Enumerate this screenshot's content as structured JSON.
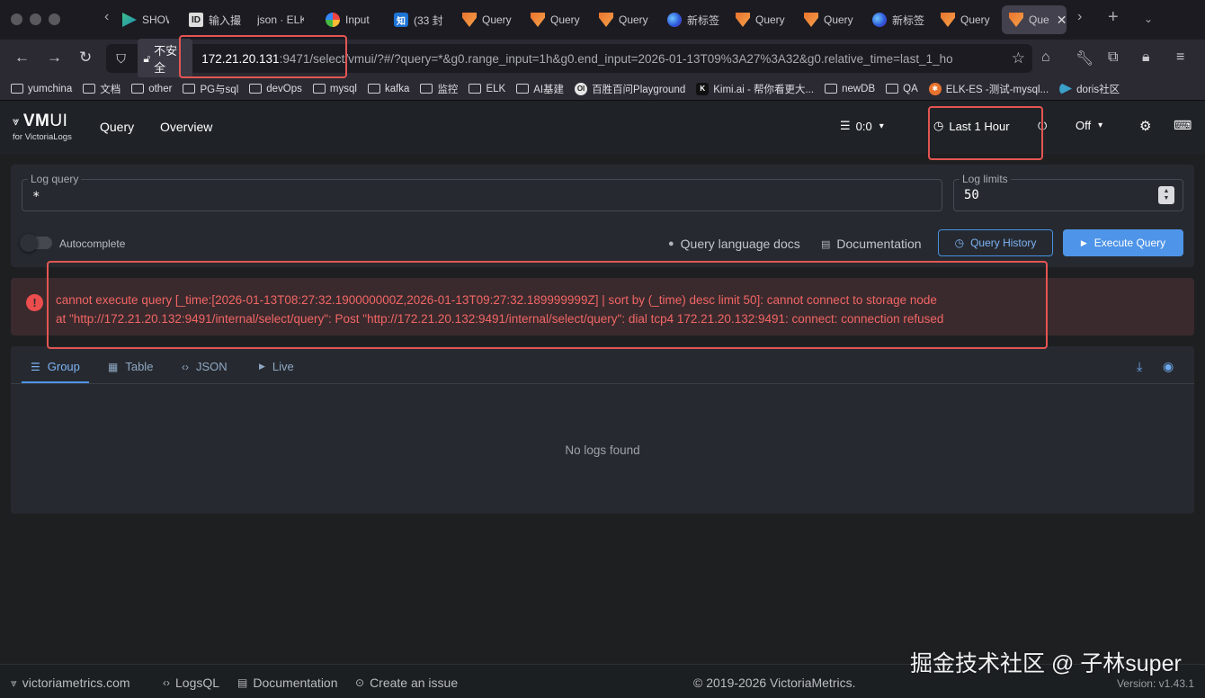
{
  "browser": {
    "tabs": [
      {
        "label": "SHOW",
        "icon": "green-arrow-icon"
      },
      {
        "label": "输入撮",
        "icon": "doc-icon"
      },
      {
        "label": "json · ELK",
        "icon": ""
      },
      {
        "label": "Input",
        "icon": "multicolor-icon"
      },
      {
        "label": "(33 封",
        "icon": "zhihu-icon"
      },
      {
        "label": "Query",
        "icon": "vm-logo-icon"
      },
      {
        "label": "Query",
        "icon": "vm-logo-icon"
      },
      {
        "label": "Query",
        "icon": "vm-logo-icon"
      },
      {
        "label": "新标签",
        "icon": "firefox-icon"
      },
      {
        "label": "Query",
        "icon": "vm-logo-icon"
      },
      {
        "label": "Query",
        "icon": "vm-logo-icon"
      },
      {
        "label": "新标签",
        "icon": "firefox-icon"
      },
      {
        "label": "Query",
        "icon": "vm-logo-icon"
      },
      {
        "label": "Que",
        "icon": "vm-logo-icon"
      }
    ],
    "insecure_label": "不安全",
    "url_host": "172.21.20.131",
    "url_rest": ":9471/select/vmui/?#/?query=*&g0.range_input=1h&g0.end_input=2026-01-13T09%3A27%3A32&g0.relative_time=last_1_ho",
    "bookmarks": [
      {
        "label": "yumchina",
        "type": "folder"
      },
      {
        "label": "文档",
        "type": "folder"
      },
      {
        "label": "other",
        "type": "folder"
      },
      {
        "label": "PG与sql",
        "type": "folder"
      },
      {
        "label": "devOps",
        "type": "folder"
      },
      {
        "label": "mysql",
        "type": "folder"
      },
      {
        "label": "kafka",
        "type": "folder"
      },
      {
        "label": "监控",
        "type": "folder"
      },
      {
        "label": "ELK",
        "type": "folder"
      },
      {
        "label": "AI基建",
        "type": "folder"
      },
      {
        "label": "百胜百问Playground",
        "type": "site"
      },
      {
        "label": "Kimi.ai - 帮你看更大...",
        "type": "site"
      },
      {
        "label": "newDB",
        "type": "folder"
      },
      {
        "label": "QA",
        "type": "folder"
      },
      {
        "label": "ELK-ES -测试-mysql...",
        "type": "site"
      },
      {
        "label": "doris社区",
        "type": "site"
      }
    ]
  },
  "app": {
    "logo_main": "VMUI",
    "logo_vm": "VM",
    "logo_ui": "UI",
    "logo_sub": "for VictoriaLogs",
    "nav": [
      "Query",
      "Overview"
    ],
    "tenant": "0:0",
    "time_range": "Last 1 Hour",
    "refresh": "Off"
  },
  "query": {
    "log_query_label": "Log query",
    "log_query_value": "*",
    "log_limits_label": "Log limits",
    "log_limits_value": "50",
    "autocomplete_label": "Autocomplete",
    "docs_label": "Query language docs",
    "documentation_label": "Documentation",
    "history_label": "Query History",
    "execute_label": "Execute Query"
  },
  "error": {
    "line1": "cannot execute query [_time:[2026-01-13T08:27:32.190000000Z,2026-01-13T09:27:32.189999999Z] | sort by (_time) desc limit 50]: cannot connect to storage node",
    "line2": "at \"http://172.21.20.132:9491/internal/select/query\": Post \"http://172.21.20.132:9491/internal/select/query\": dial tcp4 172.21.20.132:9491: connect: connection refused"
  },
  "results": {
    "tabs": [
      "Group",
      "Table",
      "JSON",
      "Live"
    ],
    "empty": "No logs found"
  },
  "footer": {
    "site": "victoriametrics.com",
    "logsql": "LogsQL",
    "documentation": "Documentation",
    "issue": "Create an issue",
    "copyright": "© 2019-2026 VictoriaMetrics.",
    "version": "Version: v1.43.1"
  },
  "watermark": "掘金技术社区 @ 子林super",
  "colors": {
    "accent": "#4e94e8",
    "error": "#f26565",
    "highlight": "#e35552"
  }
}
